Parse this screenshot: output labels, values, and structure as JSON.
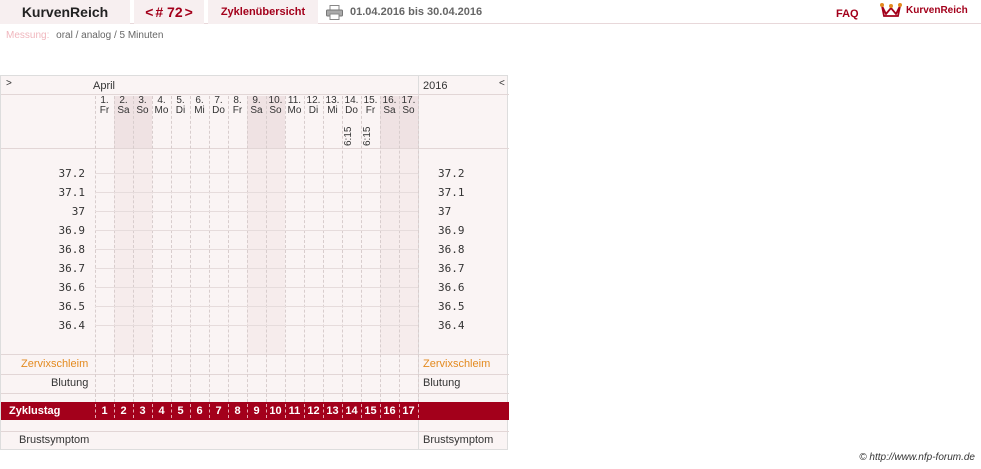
{
  "header": {
    "brand": "KurvenReich",
    "cycle_prev": "<",
    "cycle_number": "# 72",
    "cycle_next": ">",
    "overview_label": "Zyklenübersicht",
    "date_range": "01.04.2016 bis 30.04.2016",
    "faq_label": "FAQ",
    "logo_text": "KurvenReich",
    "accent_color": "#a3001b"
  },
  "measurement": {
    "label": "Messung:",
    "value": "oral / analog / 5 Minuten"
  },
  "chart": {
    "nav_prev": ">",
    "nav_next": "<",
    "month": "April",
    "year": "2016",
    "days": [
      {
        "num": "1.",
        "wd": "Fr",
        "weekend": false,
        "time": ""
      },
      {
        "num": "2.",
        "wd": "Sa",
        "weekend": true,
        "time": ""
      },
      {
        "num": "3.",
        "wd": "So",
        "weekend": true,
        "time": ""
      },
      {
        "num": "4.",
        "wd": "Mo",
        "weekend": false,
        "time": ""
      },
      {
        "num": "5.",
        "wd": "Di",
        "weekend": false,
        "time": ""
      },
      {
        "num": "6.",
        "wd": "Mi",
        "weekend": false,
        "time": ""
      },
      {
        "num": "7.",
        "wd": "Do",
        "weekend": false,
        "time": ""
      },
      {
        "num": "8.",
        "wd": "Fr",
        "weekend": false,
        "time": ""
      },
      {
        "num": "9.",
        "wd": "Sa",
        "weekend": true,
        "time": ""
      },
      {
        "num": "10.",
        "wd": "So",
        "weekend": true,
        "time": ""
      },
      {
        "num": "11.",
        "wd": "Mo",
        "weekend": false,
        "time": ""
      },
      {
        "num": "12.",
        "wd": "Di",
        "weekend": false,
        "time": ""
      },
      {
        "num": "13.",
        "wd": "Mi",
        "weekend": false,
        "time": ""
      },
      {
        "num": "14.",
        "wd": "Do",
        "weekend": false,
        "time": "6:15"
      },
      {
        "num": "15.",
        "wd": "Fr",
        "weekend": false,
        "time": "6:15"
      },
      {
        "num": "16.",
        "wd": "Sa",
        "weekend": true,
        "time": ""
      },
      {
        "num": "17.",
        "wd": "So",
        "weekend": true,
        "time": ""
      }
    ],
    "temperatures": [
      "37.2",
      "37.1",
      "37",
      "36.9",
      "36.8",
      "36.7",
      "36.6",
      "36.5",
      "36.4"
    ],
    "cervical_label": "Zervixschleim",
    "bleeding_label": "Blutung",
    "cycle_day_label": "Zyklustag",
    "cycle_days": [
      "1",
      "2",
      "3",
      "4",
      "5",
      "6",
      "7",
      "8",
      "9",
      "10",
      "11",
      "12",
      "13",
      "14",
      "15",
      "16",
      "17"
    ],
    "breast_label": "Brustsymptom",
    "weekend_color": "#efe2e3",
    "cervical_color": "#e38a1f"
  },
  "footer": {
    "copyright": "© http://www.nfp-forum.de"
  }
}
